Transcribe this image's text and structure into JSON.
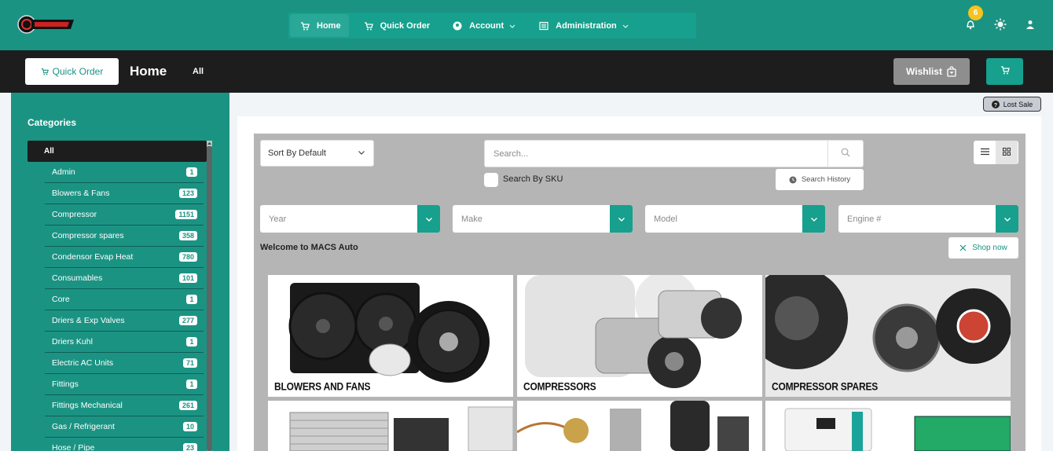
{
  "colors": {
    "brand": "#1b9383",
    "accent": "#16a08d",
    "dark": "#1d1d1d",
    "badge": "#f5c320"
  },
  "nav": {
    "logo_icon": "brand-logo",
    "items": [
      {
        "label": "Home",
        "icon": "cart-icon",
        "active": true
      },
      {
        "label": "Quick Order",
        "icon": "cart-icon"
      },
      {
        "label": "Account",
        "icon": "user-circle-icon",
        "dropdown": true
      },
      {
        "label": "Administration",
        "icon": "list-icon",
        "dropdown": true
      }
    ],
    "notifications_count": "6",
    "icons": [
      "bell-icon",
      "sun-icon",
      "user-icon"
    ]
  },
  "subbar": {
    "quick_order_label": "Quick Order",
    "page_title": "Home",
    "breadcrumb": "All",
    "wishlist_label": "Wishlist"
  },
  "sidebar": {
    "title": "Categories",
    "all_label": "All",
    "items": [
      {
        "label": "Admin",
        "count": "1"
      },
      {
        "label": "Blowers & Fans",
        "count": "123"
      },
      {
        "label": "Compressor",
        "count": "1151"
      },
      {
        "label": "Compressor spares",
        "count": "358"
      },
      {
        "label": "Condensor Evap Heat",
        "count": "780"
      },
      {
        "label": "Consumables",
        "count": "101"
      },
      {
        "label": "Core",
        "count": "1"
      },
      {
        "label": "Driers & Exp Valves",
        "count": "277"
      },
      {
        "label": "Driers Kuhl",
        "count": "1"
      },
      {
        "label": "Electric AC Units",
        "count": "71"
      },
      {
        "label": "Fittings",
        "count": "1"
      },
      {
        "label": "Fittings Mechanical",
        "count": "261"
      },
      {
        "label": "Gas / Refrigerant",
        "count": "10"
      },
      {
        "label": "Hose / Pipe",
        "count": "23"
      }
    ]
  },
  "lost_sale_label": "Lost Sale",
  "filters": {
    "sort_value": "Sort By Default",
    "search_placeholder": "Search...",
    "sku_label": "Search By SKU",
    "history_label": "Search History",
    "year_placeholder": "Year",
    "make_placeholder": "Make",
    "model_placeholder": "Model",
    "engine_placeholder": "Engine #"
  },
  "welcome_text": "Welcome to MACS Auto",
  "shop_now_label": "Shop now",
  "tiles": [
    {
      "label": "BLOWERS AND FANS"
    },
    {
      "label": "COMPRESSORS"
    },
    {
      "label": "COMPRESSOR SPARES"
    },
    {
      "label": ""
    },
    {
      "label": ""
    },
    {
      "label": ""
    }
  ]
}
